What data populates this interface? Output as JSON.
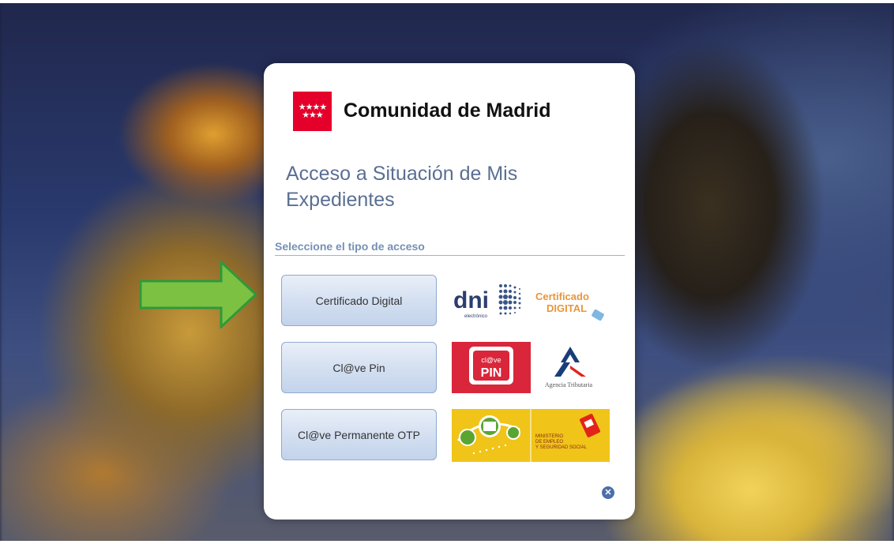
{
  "header": {
    "org_name": "Comunidad de Madrid",
    "logo_stars": "★★★★\n★★★"
  },
  "title": "Acceso a Situación de Mis Expedientes",
  "section_label": "Seleccione el tipo de acceso",
  "access_options": [
    {
      "label": "Certificado Digital",
      "logos": [
        "dni electrónico",
        "Certificado DIGITAL"
      ]
    },
    {
      "label": "Cl@ve Pin",
      "logos": [
        "cl@ve PIN",
        "Agencia Tributaria"
      ]
    },
    {
      "label": "Cl@ve Permanente OTP",
      "logos": [
        "OTP",
        "MINISTERIO DE EMPLEO Y SEGURIDAD SOCIAL"
      ]
    }
  ],
  "logo_text": {
    "dni": "dni",
    "dni_sub": "electrónico",
    "cert_line1": "Certificado",
    "cert_line2": "DIGITAL",
    "clave": "cl@ve",
    "pin": "PIN",
    "agencia": "Agencia Tributaria",
    "ministerio_1": "MINISTERIO",
    "ministerio_2": "DE EMPLEO",
    "ministerio_3": "Y SEGURIDAD SOCIAL"
  },
  "icons": {
    "close": "close-icon",
    "arrow": "arrow-pointer-icon"
  },
  "colors": {
    "brand_red": "#e4002b",
    "title_blue": "#5a6f93",
    "arrow_green": "#7dc142",
    "button_border": "#8eaad0"
  }
}
